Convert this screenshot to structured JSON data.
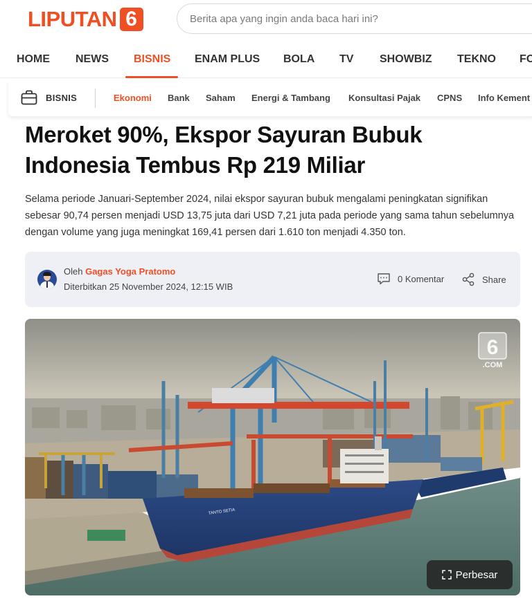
{
  "brand": {
    "logo_text": "LIPUTAN",
    "logo_numeral": "6",
    "accent_color": "#f04e23"
  },
  "search": {
    "placeholder": "Berita apa yang ingin anda baca hari ini?"
  },
  "nav": {
    "items": [
      {
        "label": "HOME"
      },
      {
        "label": "NEWS"
      },
      {
        "label": "BISNIS",
        "active": true
      },
      {
        "label": "ENAM PLUS"
      },
      {
        "label": "BOLA"
      },
      {
        "label": "TV"
      },
      {
        "label": "SHOWBIZ"
      },
      {
        "label": "TEKNO"
      },
      {
        "label": "FO"
      }
    ]
  },
  "subnav": {
    "section_icon": "briefcase-icon",
    "section_label": "BISNIS",
    "items": [
      {
        "label": "Ekonomi",
        "active": true
      },
      {
        "label": "Bank"
      },
      {
        "label": "Saham"
      },
      {
        "label": "Energi & Tambang"
      },
      {
        "label": "Konsultasi Pajak"
      },
      {
        "label": "CPNS"
      },
      {
        "label": "Info Kement"
      }
    ]
  },
  "article": {
    "headline": "Meroket 90%, Ekspor Sayuran Bubuk Indonesia Tembus Rp 219 Miliar",
    "lede": "Selama periode Januari-September 2024, nilai ekspor sayuran bubuk mengalami peningkatan signifikan sebesar 90,74 persen menjadi USD 13,75 juta dari USD 7,21 juta pada periode yang sama tahun sebelumnya dengan volume yang juga meningkat 169,41 persen dari 1.610 ton menjadi 4.350 ton.",
    "byline": {
      "prefix": "Oleh",
      "author": "Gagas Yoga Pratomo",
      "published": "Diterbitkan 25 November 2024, 12:15 WIB"
    },
    "actions": {
      "comments": "0 Komentar",
      "share": "Share"
    },
    "image": {
      "zoom_label": "Perbesar",
      "watermark_numeral": "6",
      "watermark_text": ".COM",
      "ship_name": "TANTO SETIA"
    }
  }
}
